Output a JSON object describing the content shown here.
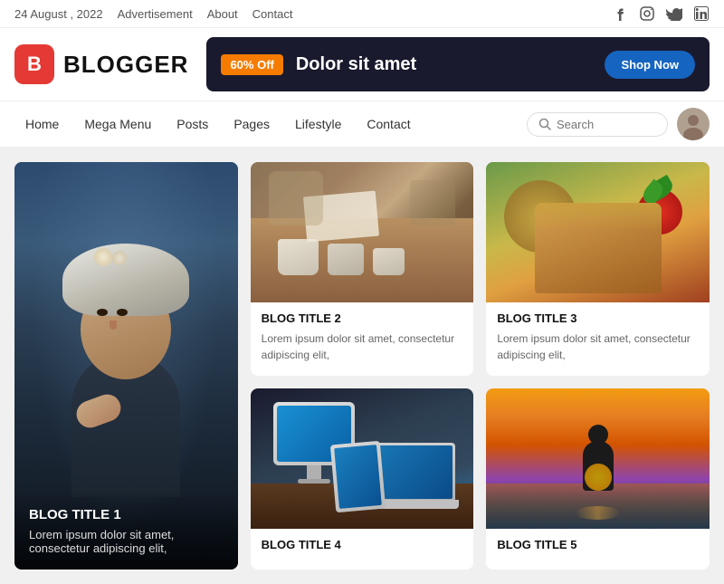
{
  "topbar": {
    "date": "24 August , 2022",
    "links": [
      "Advertisement",
      "About",
      "Contact"
    ]
  },
  "social": {
    "facebook": "f",
    "instagram": "⌂",
    "twitter": "t",
    "linkedin": "in"
  },
  "logo": {
    "icon": "B",
    "text": "BLOGGER"
  },
  "banner": {
    "badge": "60% Off",
    "text": "Dolor sit amet",
    "button": "Shop Now"
  },
  "nav": {
    "links": [
      "Home",
      "Mega Menu",
      "Posts",
      "Pages",
      "Lifestyle",
      "Contact"
    ],
    "search_placeholder": "Search"
  },
  "posts": [
    {
      "id": 1,
      "title": "BLOG TITLE 1",
      "excerpt": "Lorem ipsum dolor sit amet, consectetur adipiscing elit,",
      "featured": true,
      "img_class": "img-woman"
    },
    {
      "id": 2,
      "title": "BLOG TITLE 2",
      "excerpt": "Lorem ipsum dolor sit amet, consectetur adipiscing elit,",
      "featured": false,
      "img_class": "img-coffee"
    },
    {
      "id": 3,
      "title": "BLOG TITLE 3",
      "excerpt": "Lorem ipsum dolor sit amet, consectetur adipiscing elit,",
      "featured": false,
      "img_class": "img-food"
    },
    {
      "id": 4,
      "title": "BLOG TITLE 4",
      "excerpt": "",
      "featured": false,
      "img_class": "img-tech"
    },
    {
      "id": 5,
      "title": "BLOG TITLE 5",
      "excerpt": "",
      "featured": false,
      "img_class": "img-sunset"
    }
  ]
}
